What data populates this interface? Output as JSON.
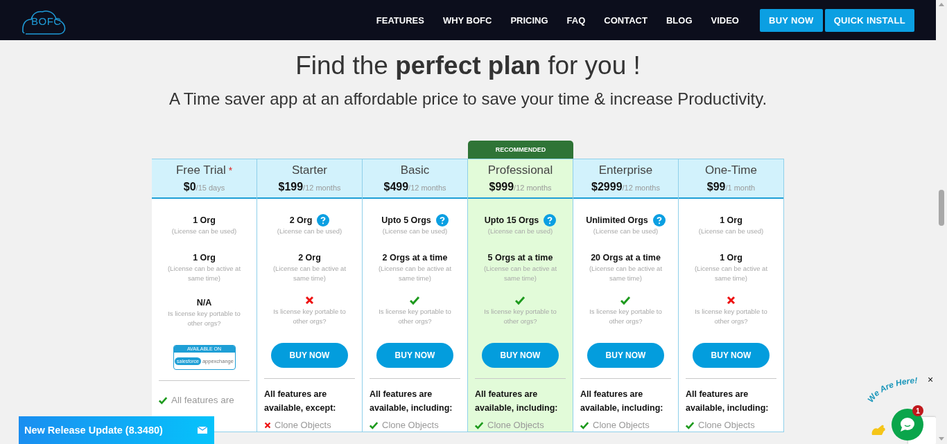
{
  "nav": {
    "logo": "BOFC",
    "links": [
      {
        "label": "FEATURES"
      },
      {
        "label": "WHY BOFC"
      },
      {
        "label": "PRICING"
      },
      {
        "label": "FAQ"
      },
      {
        "label": "CONTACT"
      },
      {
        "label": "BLOG"
      },
      {
        "label": "VIDEO"
      }
    ],
    "buttons": [
      {
        "label": "BUY NOW"
      },
      {
        "label": "QUICK INSTALL"
      }
    ]
  },
  "hero": {
    "title": "Find the **perfect plan** for you !",
    "subtitle": "A Time saver app at an affordable price to save your time & increase Productivity."
  },
  "plans": [
    {
      "name": "Free Trial",
      "marker": "*",
      "price": "$0",
      "period": "/15 days",
      "recommended": false,
      "used": {
        "value": "1 Org",
        "note": "(License can be used)",
        "help": false
      },
      "active": {
        "value": "1 Org",
        "note": "(License can be active at same time)"
      },
      "portable": {
        "kind": "text",
        "text": "N/A",
        "note": "Is license key portable to other orgs?"
      },
      "action": {
        "kind": "badge",
        "caption": "AVAILABLE ON",
        "brand": "salesforce",
        "label": "appexchange"
      },
      "features": {
        "kind": "note",
        "items": [
          {
            "text": "All features are",
            "included": true
          }
        ]
      }
    },
    {
      "name": "Starter",
      "price": "$199",
      "period": "/12 months",
      "recommended": false,
      "used": {
        "value": "2 Org",
        "note": "(License can be used)",
        "help": true
      },
      "active": {
        "value": "2 Org",
        "note": "(License can be active at same time)"
      },
      "portable": {
        "kind": "no",
        "note": "Is license key portable to other orgs?"
      },
      "action": {
        "kind": "button",
        "label": "BUY NOW"
      },
      "features": {
        "kind": "list",
        "heading": "All features are available, except:",
        "items": [
          {
            "text": "Clone Objects",
            "included": false
          }
        ]
      }
    },
    {
      "name": "Basic",
      "price": "$499",
      "period": "/12 months",
      "recommended": false,
      "used": {
        "value": "Upto 5 Orgs",
        "note": "(License can be used)",
        "help": true
      },
      "active": {
        "value": "2 Orgs at a time",
        "note": "(License can be active at same time)"
      },
      "portable": {
        "kind": "yes",
        "note": "Is license key portable to other orgs?"
      },
      "action": {
        "kind": "button",
        "label": "BUY NOW"
      },
      "features": {
        "kind": "list",
        "heading": "All features are available, including:",
        "items": [
          {
            "text": "Clone Objects",
            "included": true
          }
        ]
      }
    },
    {
      "name": "Professional",
      "ribbon": "RECOMMENDED",
      "price": "$999",
      "period": "/12 months",
      "recommended": true,
      "used": {
        "value": "Upto 15 Orgs",
        "note": "(License can be used)",
        "help": true
      },
      "active": {
        "value": "5 Orgs at a time",
        "note": "(License can be active at same time)"
      },
      "portable": {
        "kind": "yes",
        "note": "Is license key portable to other orgs?"
      },
      "action": {
        "kind": "button",
        "label": "BUY NOW"
      },
      "features": {
        "kind": "list",
        "heading": "All features are available, including:",
        "items": [
          {
            "text": "Clone Objects",
            "included": true
          }
        ]
      }
    },
    {
      "name": "Enterprise",
      "price": "$2999",
      "period": "/12 months",
      "recommended": false,
      "used": {
        "value": "Unlimited Orgs",
        "note": "(License can be used)",
        "help": true
      },
      "active": {
        "value": "20 Orgs at a time",
        "note": "(License can be active at same time)"
      },
      "portable": {
        "kind": "yes",
        "note": "Is license key portable to other orgs?"
      },
      "action": {
        "kind": "button",
        "label": "BUY NOW"
      },
      "features": {
        "kind": "list",
        "heading": "All features are available, including:",
        "items": [
          {
            "text": "Clone Objects",
            "included": true
          }
        ]
      }
    },
    {
      "name": "One-Time",
      "price": "$99",
      "period": "/1 month",
      "recommended": false,
      "used": {
        "value": "1 Org",
        "note": "(License can be used)",
        "help": false
      },
      "active": {
        "value": "1 Org",
        "note": "(License can be active at same time)"
      },
      "portable": {
        "kind": "no",
        "note": "Is license key portable to other orgs?"
      },
      "action": {
        "kind": "button",
        "label": "BUY NOW"
      },
      "features": {
        "kind": "list",
        "heading": "All features are available, including:",
        "items": [
          {
            "text": "Clone Objects",
            "included": true
          }
        ]
      }
    }
  ],
  "release_banner": {
    "label": "New Release Update (8.3480)"
  },
  "chat": {
    "caption": "We Are Here!",
    "close": "×",
    "unread": "1"
  }
}
